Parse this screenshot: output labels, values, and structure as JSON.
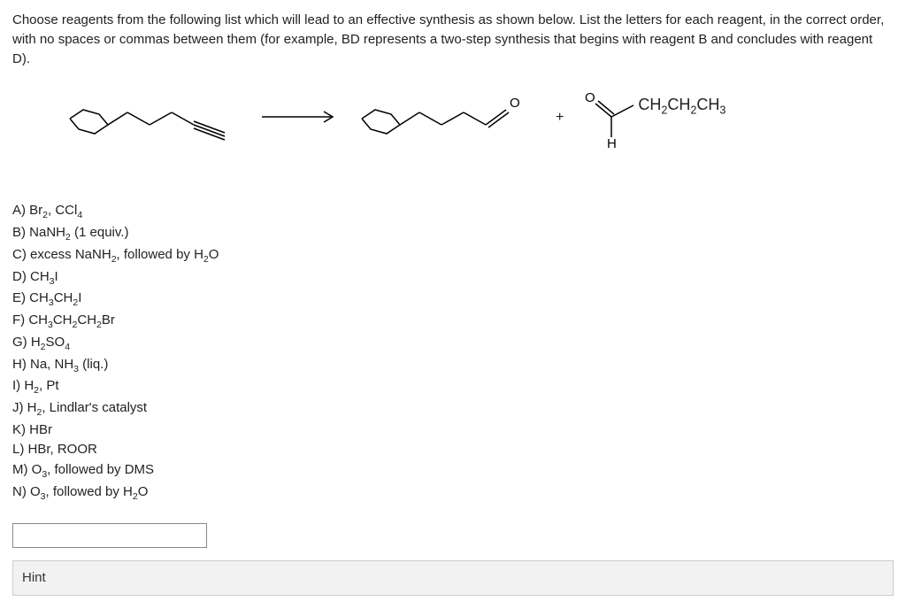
{
  "instructions": "Choose reagents from the following list which will lead to an effective synthesis as shown below. List the letters for each reagent, in the correct order, with no spaces or commas between them (for example, BD represents a two-step synthesis that begins with reagent B and concludes with reagent D).",
  "reaction": {
    "plus": "+",
    "product2_tail": "CH",
    "product2_tail2": "CH",
    "product2_tail3": "CH",
    "sub2a": "2",
    "sub2b": "2",
    "sub3": "3",
    "H_label": "H",
    "O_label": "O"
  },
  "reagents": [
    {
      "letter": "A)",
      "text_html": "Br<sub>2</sub>, CCl<sub>4</sub>"
    },
    {
      "letter": "B)",
      "text_html": "NaNH<sub>2</sub> (1 equiv.)"
    },
    {
      "letter": "C)",
      "text_html": "excess NaNH<sub>2</sub>, followed by H<sub>2</sub>O"
    },
    {
      "letter": "D)",
      "text_html": "CH<sub>3</sub>I"
    },
    {
      "letter": "E)",
      "text_html": "CH<sub>3</sub>CH<sub>2</sub>I"
    },
    {
      "letter": "F)",
      "text_html": "CH<sub>3</sub>CH<sub>2</sub>CH<sub>2</sub>Br"
    },
    {
      "letter": "G)",
      "text_html": "H<sub>2</sub>SO<sub>4</sub>"
    },
    {
      "letter": "H)",
      "text_html": "Na, NH<sub>3</sub> (liq.)"
    },
    {
      "letter": "I)",
      "text_html": "H<sub>2</sub>, Pt"
    },
    {
      "letter": "J)",
      "text_html": "H<sub>2</sub>, Lindlar's catalyst"
    },
    {
      "letter": "K)",
      "text_html": "HBr"
    },
    {
      "letter": "L)",
      "text_html": "HBr, ROOR"
    },
    {
      "letter": "M)",
      "text_html": "O<sub>3</sub>, followed by DMS"
    },
    {
      "letter": "N)",
      "text_html": "O<sub>3</sub>, followed by H<sub>2</sub>O"
    }
  ],
  "answer": {
    "value": "",
    "placeholder": ""
  },
  "hint_label": "Hint"
}
